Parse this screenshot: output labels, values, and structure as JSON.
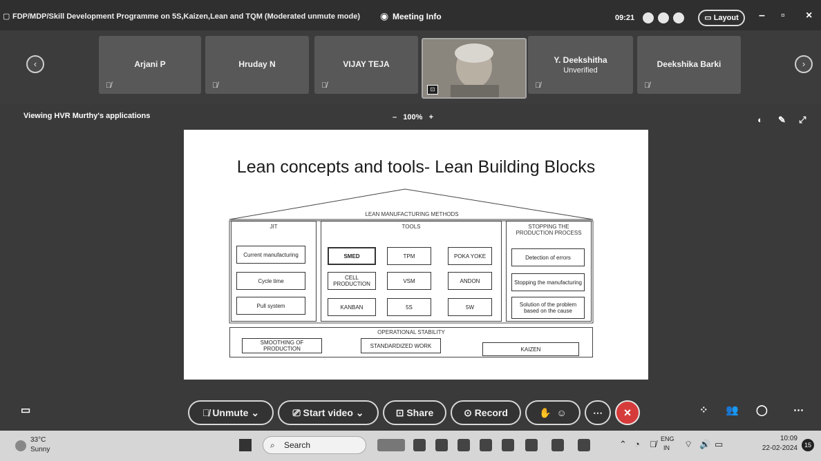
{
  "window": {
    "title": "FDP/MDP/Skill Development Programme on 5S,Kaizen,Lean and TQM (Moderated unmute mode)",
    "meeting_info": "Meeting Info",
    "clock": "09:21",
    "layout_label": "Layout",
    "minimize": "–",
    "maximize": "▫",
    "close": "×"
  },
  "participants": [
    {
      "name": "Arjani P"
    },
    {
      "name": "Hruday N"
    },
    {
      "name": "VIJAY TEJA"
    },
    {
      "name": "Y. Deekshitha",
      "status": "Unverified"
    },
    {
      "name": "Deekshika Barki"
    }
  ],
  "share_bar": {
    "viewing": "Viewing HVR Murthy's applications",
    "zoom_minus": "–",
    "zoom": "100%",
    "zoom_plus": "+"
  },
  "slide": {
    "title": "Lean concepts and tools- Lean Building Blocks",
    "roof": "LEAN MANUFACTURING METHODS",
    "jit_header": "JIT",
    "jit_items": [
      "Current manufacturing",
      "Cycle time",
      "Pull system"
    ],
    "tools_header": "TOOLS",
    "tools_items": [
      "SMED",
      "TPM",
      "POKA YOKE",
      "CELL PRODUCTION",
      "VSM",
      "ANDON",
      "KANBAN",
      "5S",
      "5W"
    ],
    "stop_header": "STOPPING THE PRODUCTION PROCESS",
    "stop_items": [
      "Detection of errors",
      "Stopping the manufacturing",
      "Solution of the problem based on the cause"
    ],
    "base_header": "OPERATIONAL STABILITY",
    "base_items": [
      "SMOOTHING OF PRODUCTION",
      "STANDARDIZED WORK",
      "KAIZEN"
    ]
  },
  "toolbar": {
    "unmute": "Unmute",
    "start_video": "Start video",
    "share": "Share",
    "record": "Record"
  },
  "taskbar": {
    "temperature": "33°C",
    "weather": "Sunny",
    "search": "Search",
    "lang_top": "ENG",
    "lang_bottom": "IN",
    "time": "10:09",
    "date": "22-02-2024",
    "notification_count": "15"
  }
}
